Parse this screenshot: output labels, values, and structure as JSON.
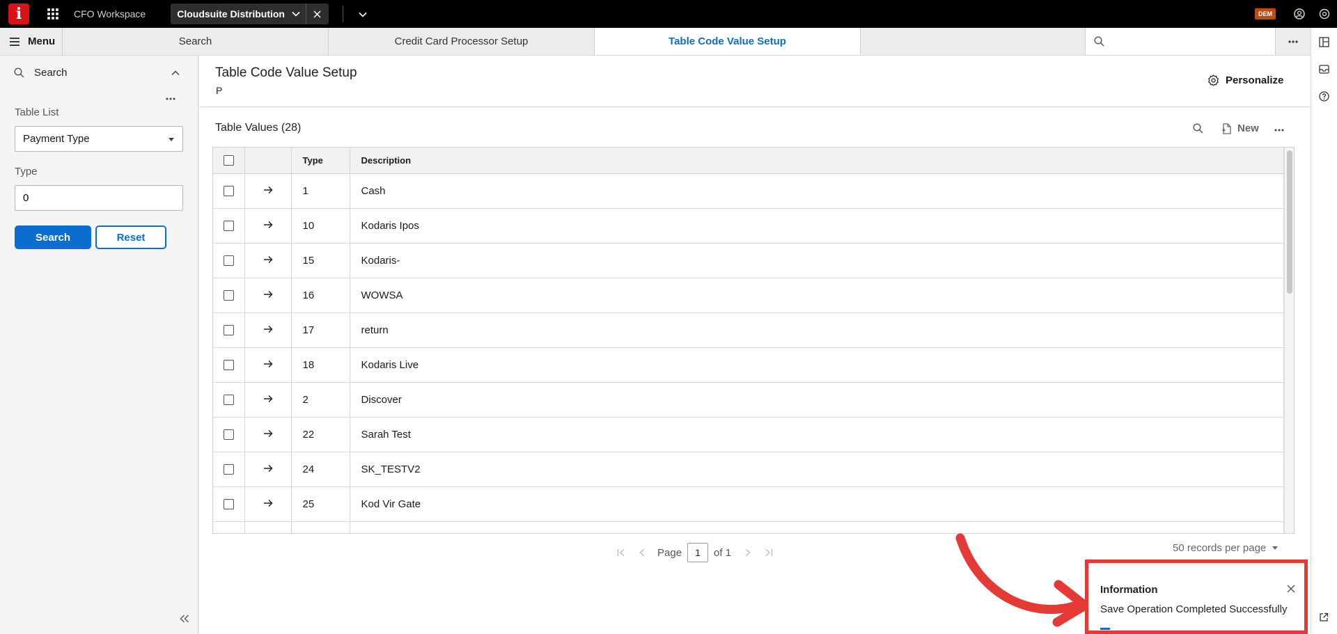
{
  "header": {
    "logo_letter": "i",
    "workspace": "CFO Workspace",
    "app_name": "Cloudsuite Distribution",
    "user_badge": "DEM"
  },
  "tabs": {
    "menu_label": "Menu",
    "items": [
      {
        "label": "Search",
        "active": false
      },
      {
        "label": "Credit Card Processor Setup",
        "active": false
      },
      {
        "label": "Table Code Value Setup",
        "active": true
      }
    ],
    "search_placeholder": ""
  },
  "left_panel": {
    "search_title": "Search",
    "table_list_label": "Table List",
    "table_list_value": "Payment Type",
    "type_label": "Type",
    "type_value": "0",
    "search_button": "Search",
    "reset_button": "Reset"
  },
  "main": {
    "title": "Table Code Value Setup",
    "subtitle": "P",
    "personalize_label": "Personalize",
    "grid_title": "Table Values (28)",
    "new_label": "New",
    "columns": [
      "Type",
      "Description"
    ],
    "rows": [
      {
        "type": "1",
        "description": "Cash"
      },
      {
        "type": "10",
        "description": "Kodaris Ipos"
      },
      {
        "type": "15",
        "description": "Kodaris-"
      },
      {
        "type": "16",
        "description": "WOWSA"
      },
      {
        "type": "17",
        "description": "return"
      },
      {
        "type": "18",
        "description": "Kodaris Live"
      },
      {
        "type": "2",
        "description": "Discover"
      },
      {
        "type": "22",
        "description": "Sarah Test"
      },
      {
        "type": "24",
        "description": "SK_TESTV2"
      },
      {
        "type": "25",
        "description": "Kod Vir Gate"
      }
    ],
    "pager": {
      "page_label": "Page",
      "page_value": "1",
      "of_label": "of 1",
      "per_page": "50 records per page"
    }
  },
  "toast": {
    "title": "Information",
    "message": "Save Operation Completed Successfully"
  },
  "colors": {
    "accent": "#0a6ed1",
    "brand": "#da1217",
    "annotation": "#e53935"
  }
}
